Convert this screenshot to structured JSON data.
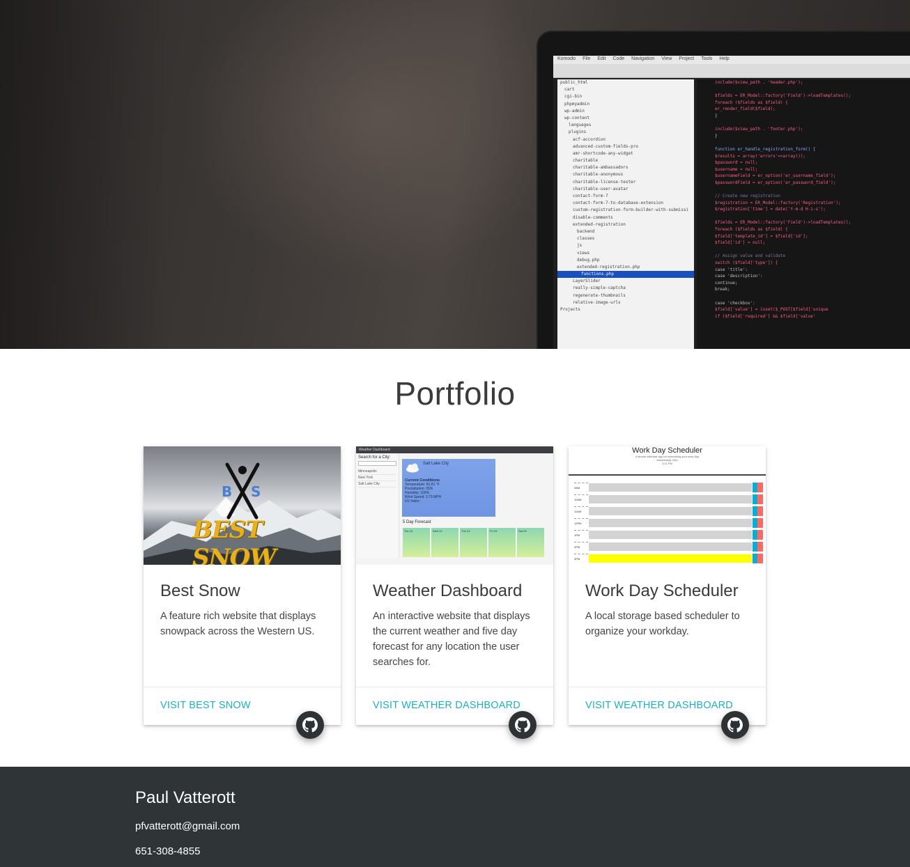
{
  "hero": {
    "editor_menu": [
      "Komodo",
      "File",
      "Edit",
      "Code",
      "Navigation",
      "View",
      "Project",
      "Tools",
      "Help"
    ],
    "file_tree": [
      "public_html",
      "cart",
      "cgi-bin",
      "phpmyadmin",
      "wp-admin",
      "wp-content",
      "languages",
      "plugins",
      "acf-accordion",
      "advanced-custom-fields-pro",
      "amr-shortcode-any-widget",
      "charitable",
      "charitable-ambassadors",
      "charitable-anonymous",
      "charitable-license-tester",
      "charitable-user-avatar",
      "contact-form-7",
      "contact-form-7-to-database-extension",
      "custom-registration-form-builder-with-submissi",
      "disable-comments",
      "extended-registration",
      "backend",
      "classes",
      "js",
      "views",
      "debug.php",
      "extended-registration.php",
      "functions.php",
      "LayerSlider",
      "really-simple-captcha",
      "regenerate-thumbnails",
      "relative-image-urls",
      "Projects"
    ],
    "code_lines": [
      "include($view_path . 'header.php');",
      "",
      "$fields = ER_Model::factory('Field')->loadTemplates();",
      "foreach ($fields as $field) {",
      "  er_render_field($field);",
      "}",
      "",
      "include($view_path . 'footer.php');",
      "}",
      "",
      "function er_handle_registration_form() {",
      "  $results = array('errors'=>array());",
      "  $password = null;",
      "  $username = null;",
      "  $usernameField = er_option('er_username_field');",
      "  $passwordField = er_option('er_password_field');",
      "",
      "  // Create new registration",
      "  $registration = ER_Model::factory('Registration');",
      "  $registration['time'] = date('Y-m-d H-i-s');",
      "",
      "  $fields = ER_Model::factory('Field')->loadTemplates();",
      "  foreach ($fields as $field) {",
      "    $field['template_id'] = $field['id'];",
      "    $field['id'] = null;",
      "",
      "    // Assign value and validate",
      "    switch ($field['type']) {",
      "      case 'title':",
      "      case 'description':",
      "        continue;",
      "        break;",
      "",
      "      case 'checkbox':",
      "        $field['value'] = isset($_POST[$field['unique",
      "        if ($field['required'] && $field['value'"
    ]
  },
  "portfolio": {
    "title": "Portfolio",
    "cards": [
      {
        "title": "Best Snow",
        "description": "A feature rich website that displays snowpack across the Western US.",
        "link": "VISIT BEST SNOW",
        "thumb_logo_text": "BEST SNOW",
        "thumb_initials": "BS"
      },
      {
        "title": "Weather Dashboard",
        "description": "An interactive website that displays the current weather and five day forecast for any location the user searches for.",
        "link": "VISIT WEATHER DASHBOARD",
        "thumb": {
          "header": "Weather Dashboard",
          "search_label": "Search for a City:",
          "cities": [
            "Minneapolis",
            "New York",
            "Salt Lake City"
          ],
          "city": "Salt Lake City",
          "conditions_title": "Current Conditions",
          "conditions": [
            "Temperature: 81.81 °F",
            "Precipitation: 35%",
            "Humidity: 100%",
            "Wind Speed: 3.75 MPH",
            "UV Index:"
          ],
          "forecast_title": "5 Day Forecast",
          "days": [
            "Tue 24",
            "Wed 22",
            "Thu 23",
            "Fri 24",
            "Sat 25"
          ]
        }
      },
      {
        "title": "Work Day Scheduler",
        "description": "A local storage based scheduler to organize your workday.",
        "link": "VISIT WEATHER DASHBOARD",
        "thumb": {
          "header": "Work Day Scheduler",
          "sub1": "A simple calendar app for scheduling your work day",
          "sub2": "Wednesday 23rd",
          "sub3": "4:11 PM",
          "hours": [
            "9AM",
            "10AM",
            "11AM",
            "12PM",
            "1PM",
            "2PM",
            "3PM"
          ]
        }
      }
    ]
  },
  "footer": {
    "name": "Paul Vatterott",
    "email": "pfvatterott@gmail.com",
    "phone": "651-308-4855"
  },
  "colors": {
    "accent_link": "#1ab1c7",
    "footer_bg": "#2f3437",
    "fab_bg": "#2f3235"
  }
}
